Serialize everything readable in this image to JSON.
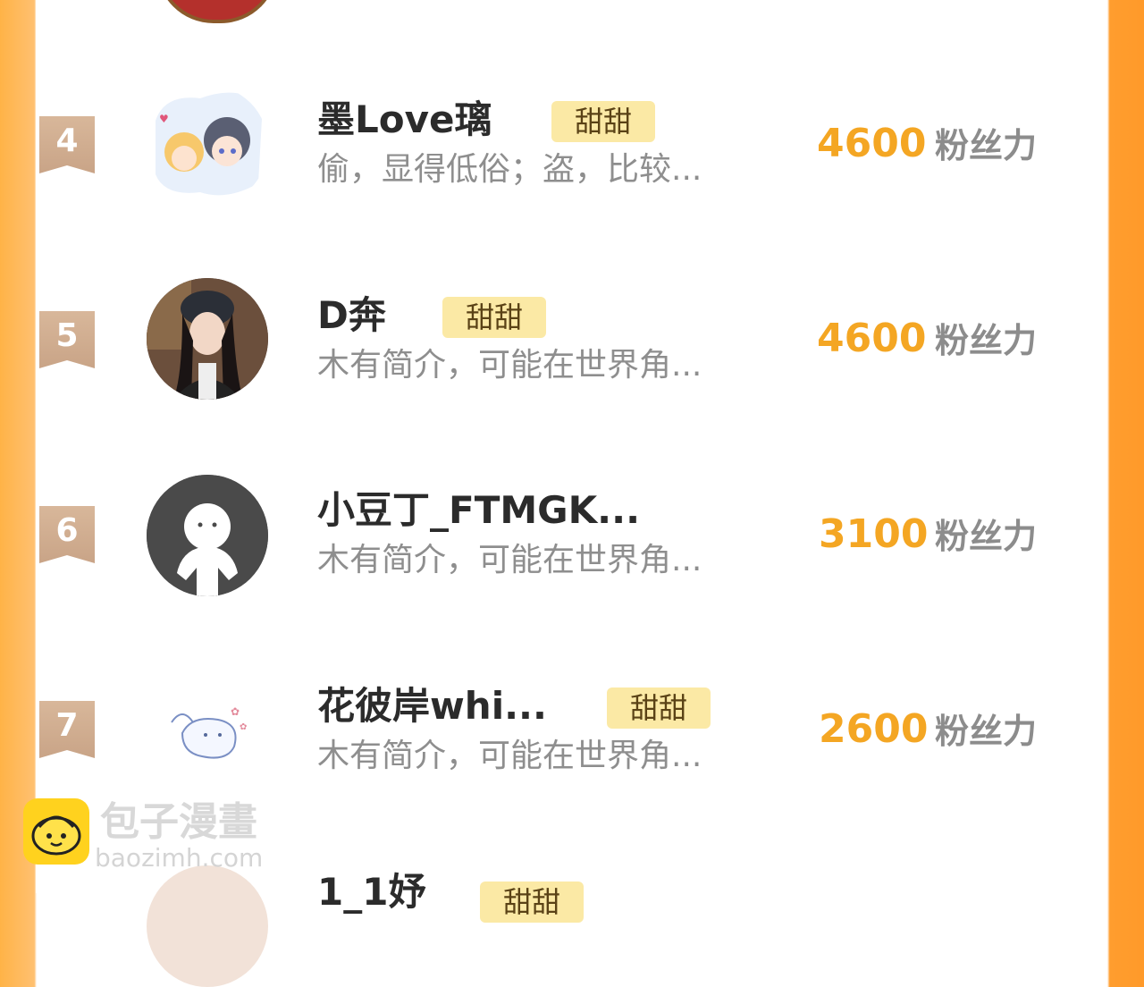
{
  "unit_label": "粉丝力",
  "tag_label": "甜甜",
  "entries": [
    {
      "rank": "4",
      "name": "墨Love璃",
      "tag": "甜甜",
      "bio": "偷，显得低俗；盗，比较...",
      "score": "4600"
    },
    {
      "rank": "5",
      "name": "D奔",
      "tag": "甜甜",
      "bio": "木有简介，可能在世界角...",
      "score": "4600"
    },
    {
      "rank": "6",
      "name": "小豆丁_FTMGK...",
      "tag": "",
      "bio": "木有简介，可能在世界角...",
      "score": "3100"
    },
    {
      "rank": "7",
      "name": "花彼岸whi...",
      "tag": "甜甜",
      "bio": "木有简介，可能在世界角...",
      "score": "2600"
    },
    {
      "rank": "",
      "name": "1_1妤",
      "tag": "甜甜",
      "bio": "",
      "score": ""
    }
  ],
  "watermark": {
    "title": "包子漫畫",
    "url": "baozimh.com"
  },
  "colors": {
    "score": "#f4a623",
    "tag_bg": "#fbe9a5",
    "accent_right": "#ff9a2a"
  }
}
